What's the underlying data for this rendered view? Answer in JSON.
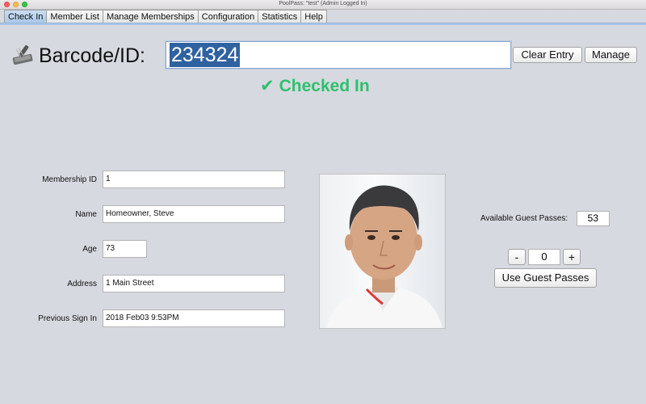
{
  "window": {
    "title": "PoolPass: \"test\" (Admin Logged In)"
  },
  "tabs": [
    {
      "label": "Check In"
    },
    {
      "label": "Member List"
    },
    {
      "label": "Manage Memberships"
    },
    {
      "label": "Configuration"
    },
    {
      "label": "Statistics"
    },
    {
      "label": "Help"
    }
  ],
  "checkin": {
    "barcode_label": "Barcode/ID:",
    "barcode_value": "234324",
    "clear_label": "Clear Entry",
    "manage_label": "Manage",
    "status_text": "Checked In",
    "status_color": "#2fc06e",
    "status_icon": "check-icon"
  },
  "member": {
    "id_label": "Membership ID",
    "id_value": "1",
    "name_label": "Name",
    "name_value": "Homeowner, Steve",
    "age_label": "Age",
    "age_value": "73",
    "address_label": "Address",
    "address_value": "1 Main Street",
    "prev_label": "Previous Sign In",
    "prev_value": "2018 Feb03 9:53PM"
  },
  "guests": {
    "available_label": "Available Guest Passes:",
    "available_value": "53",
    "minus_label": "-",
    "stepper_value": "0",
    "plus_label": "+",
    "use_label": "Use Guest Passes"
  }
}
